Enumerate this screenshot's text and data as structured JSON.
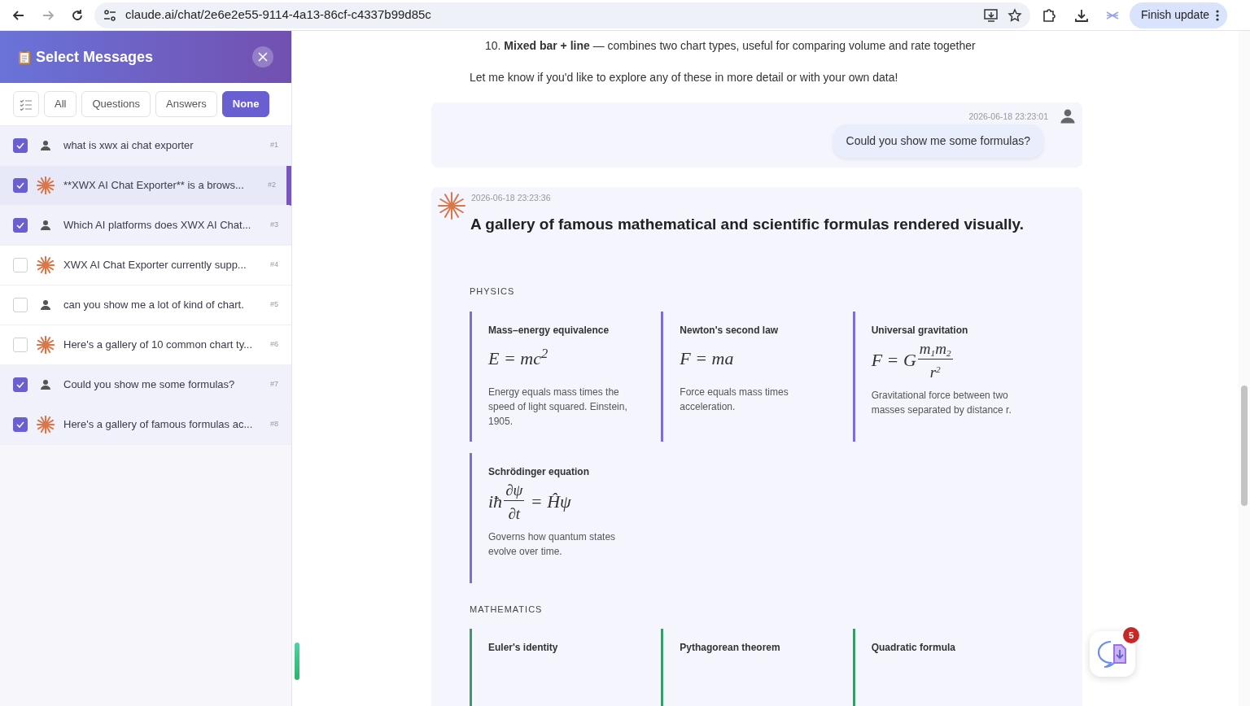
{
  "browser": {
    "url": "claude.ai/chat/2e6e2e55-9114-4a13-86cf-c4337b99d85c",
    "update_button": "Finish update"
  },
  "panel": {
    "title": "Select Messages",
    "filters": [
      {
        "label": "All",
        "selected": false
      },
      {
        "label": "Questions",
        "selected": false
      },
      {
        "label": "Answers",
        "selected": false
      },
      {
        "label": "None",
        "selected": true
      }
    ],
    "messages": [
      {
        "kind": "user",
        "text": "what is xwx ai chat exporter",
        "index": "#1",
        "checked": true,
        "current": false
      },
      {
        "kind": "assistant",
        "text": "**XWX AI Chat Exporter** is a brows...",
        "index": "#2",
        "checked": true,
        "current": true
      },
      {
        "kind": "user",
        "text": "Which AI platforms does XWX AI Chat...",
        "index": "#3",
        "checked": true,
        "current": false
      },
      {
        "kind": "assistant",
        "text": "XWX AI Chat Exporter currently supp...",
        "index": "#4",
        "checked": false,
        "current": false
      },
      {
        "kind": "user",
        "text": "can you show me a lot of kind of chart.",
        "index": "#5",
        "checked": false,
        "current": false
      },
      {
        "kind": "assistant",
        "text": "Here's a gallery of 10 common chart ty...",
        "index": "#6",
        "checked": false,
        "current": false
      },
      {
        "kind": "user",
        "text": "Could you show me some formulas?",
        "index": "#7",
        "checked": true,
        "current": false
      },
      {
        "kind": "assistant",
        "text": "Here's a gallery of famous formulas ac...",
        "index": "#8",
        "checked": true,
        "current": false
      }
    ]
  },
  "chat": {
    "list_item": {
      "number": "10.",
      "text": "**Mixed bar + line** — combines two chart types, useful for comparing volume and rate together"
    },
    "closing": "Let me know if you'd like to explore any of these in more detail or with your own data!",
    "question": {
      "time": "2026-06-18 23:23:01",
      "text": "Could you show me some formulas?"
    },
    "answer": {
      "time": "2026-06-18 23:23:36",
      "heading": "A gallery of famous mathematical and scientific formulas rendered visually.",
      "sections": [
        {
          "title": "PHYSICS",
          "color": "#7b6fd6",
          "cards": [
            {
              "name": "Mass–energy equivalence",
              "formula": [
                {
                  "text": "E = mc$^{2}$"
                }
              ],
              "description": "Energy equals mass times the speed of light squared. Einstein, 1905."
            },
            {
              "name": "Newton's second law",
              "formula": [
                {
                  "text": "F = ma"
                }
              ],
              "description": "Force equals mass times acceleration."
            },
            {
              "name": "Universal gravitation",
              "formula": [
                {
                  "text": "F = G"
                },
                {
                  "num": "m$_{1}$m$_{2}$",
                  "den": "r$^{2}$"
                }
              ],
              "description": "Gravitational force between two masses separated by distance r."
            },
            {
              "name": "Schrödinger equation",
              "formula": [
                {
                  "text": "iħ"
                },
                {
                  "num": "∂ψ",
                  "den": "∂t"
                },
                {
                  "text": " = Ĥψ"
                }
              ],
              "description": "Governs how quantum states evolve over time."
            }
          ]
        },
        {
          "title": "MATHEMATICS",
          "color": "#3a9a6a",
          "cards": [
            {
              "name": "Euler's identity"
            },
            {
              "name": "Pythagorean theorem"
            },
            {
              "name": "Quadratic formula"
            }
          ]
        }
      ]
    }
  },
  "export_badge": "5"
}
